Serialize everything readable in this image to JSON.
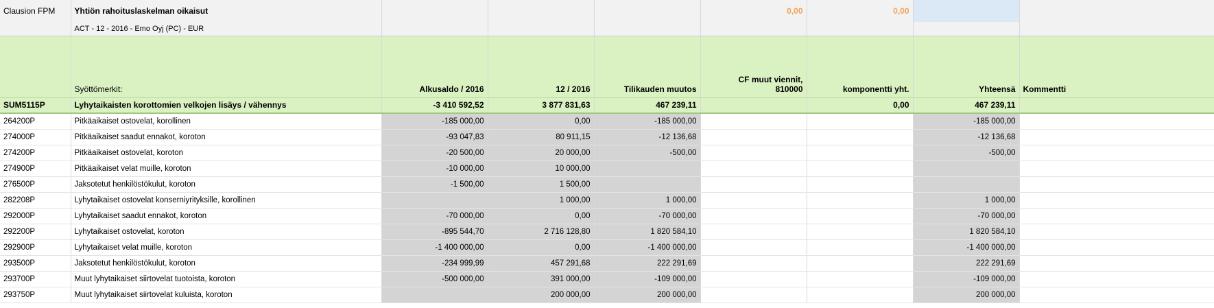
{
  "header": {
    "label": "Clausion FPM",
    "title": "Yhtiön rahoituslaskelman oikaisut",
    "value_a": "0,00",
    "value_b": "0,00",
    "subtitle": "ACT - 12 - 2016 - Emo Oyj (PC) - EUR"
  },
  "columns": {
    "syottomerkit": "Syöttömerkit:",
    "alkusaldo": "Alkusaldo / 2016",
    "period": "12 / 2016",
    "muutos": "Tilikauden muutos",
    "cf_line1": "CF muut viennit,",
    "cf_line2": "810000",
    "komponentti": "komponentti yht.",
    "yhteensa": "Yhteensä",
    "kommentti": "Kommentti"
  },
  "sum_row": {
    "code": "SUM5115P",
    "name": "Lyhytaikaisten korottomien velkojen lisäys / vähennys",
    "alkusaldo": "-3 410 592,52",
    "period": "3 877 831,63",
    "muutos": "467 239,11",
    "cf": "",
    "komponentti": "0,00",
    "yhteensa": "467 239,11"
  },
  "rows": [
    {
      "code": "264200P",
      "name": "Pitkäaikaiset ostovelat, korollinen",
      "alkusaldo": "-185 000,00",
      "period": "0,00",
      "muutos": "-185 000,00",
      "yhteensa": "-185 000,00"
    },
    {
      "code": "274000P",
      "name": "Pitkäaikaiset saadut ennakot, koroton",
      "alkusaldo": "-93 047,83",
      "period": "80 911,15",
      "muutos": "-12 136,68",
      "yhteensa": "-12 136,68"
    },
    {
      "code": "274200P",
      "name": "Pitkäaikaiset ostovelat, koroton",
      "alkusaldo": "-20 500,00",
      "period": "20 000,00",
      "muutos": "-500,00",
      "yhteensa": "-500,00"
    },
    {
      "code": "274900P",
      "name": "Pitkäaikaiset velat muille, koroton",
      "alkusaldo": "-10 000,00",
      "period": "10 000,00",
      "muutos": "",
      "yhteensa": ""
    },
    {
      "code": "276500P",
      "name": "Jaksotetut henkilöstökulut, koroton",
      "alkusaldo": "-1 500,00",
      "period": "1 500,00",
      "muutos": "",
      "yhteensa": ""
    },
    {
      "code": "282208P",
      "name": "Lyhytaikaiset ostovelat konserniyrityksille, korollinen",
      "alkusaldo": "",
      "period": "1 000,00",
      "muutos": "1 000,00",
      "yhteensa": "1 000,00"
    },
    {
      "code": "292000P",
      "name": "Lyhytaikaiset saadut ennakot, koroton",
      "alkusaldo": "-70 000,00",
      "period": "0,00",
      "muutos": "-70 000,00",
      "yhteensa": "-70 000,00"
    },
    {
      "code": "292200P",
      "name": "Lyhytaikaiset ostovelat, koroton",
      "alkusaldo": "-895 544,70",
      "period": "2 716 128,80",
      "muutos": "1 820 584,10",
      "yhteensa": "1 820 584,10"
    },
    {
      "code": "292900P",
      "name": "Lyhytaikaiset velat muille, koroton",
      "alkusaldo": "-1 400 000,00",
      "period": "0,00",
      "muutos": "-1 400 000,00",
      "yhteensa": "-1 400 000,00"
    },
    {
      "code": "293500P",
      "name": "Jaksotetut henkilöstökulut, koroton",
      "alkusaldo": "-234 999,99",
      "period": "457 291,68",
      "muutos": "222 291,69",
      "yhteensa": "222 291,69"
    },
    {
      "code": "293700P",
      "name": "Muut lyhytaikaiset siirtovelat tuotoista, koroton",
      "alkusaldo": "-500 000,00",
      "period": "391 000,00",
      "muutos": "-109 000,00",
      "yhteensa": "-109 000,00"
    },
    {
      "code": "293750P",
      "name": "Muut lyhytaikaiset siirtovelat kuluista, koroton",
      "alkusaldo": "",
      "period": "200 000,00",
      "muutos": "200 000,00",
      "yhteensa": "200 000,00"
    }
  ]
}
